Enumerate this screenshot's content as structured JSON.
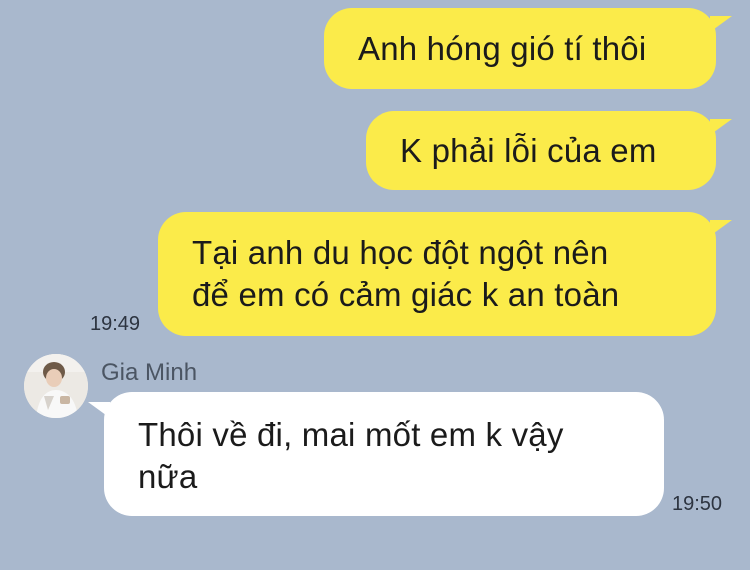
{
  "chat": {
    "messages": [
      {
        "id": "m1",
        "direction": "outgoing",
        "text": "Anh hóng gió tí thôi"
      },
      {
        "id": "m2",
        "direction": "outgoing",
        "text": "K phải lỗi của em"
      },
      {
        "id": "m3",
        "direction": "outgoing",
        "lines": [
          "Tại anh du học đột ngột nên",
          "để em có cảm giác k an toàn"
        ],
        "time": "19:49"
      },
      {
        "id": "m4",
        "direction": "incoming",
        "sender": "Gia Minh",
        "lines": [
          "Thôi về đi, mai mốt em k vậy",
          "nữa"
        ],
        "time": "19:50"
      }
    ]
  },
  "colors": {
    "background": "#a9b8cd",
    "outgoing_bubble": "#fbeb4a",
    "incoming_bubble": "#ffffff"
  },
  "icons": {
    "avatar": "profile-photo"
  }
}
